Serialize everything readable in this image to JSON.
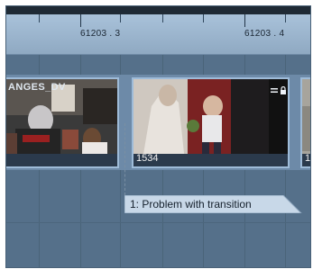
{
  "ruler": {
    "label_a": "61203 . 3",
    "label_b": "61203 . 4"
  },
  "clips": [
    {
      "name": "ANGES_DV",
      "frame": ""
    },
    {
      "name": "",
      "frame": "1534"
    },
    {
      "name": "",
      "frame": "1"
    }
  ],
  "marker": {
    "label": "1: Problem with transition"
  },
  "colors": {
    "ruler": "#a9c2da",
    "track_bg": "#55708a",
    "clip_border": "#9ebbd8",
    "marker_fill": "#c8d8e8"
  }
}
